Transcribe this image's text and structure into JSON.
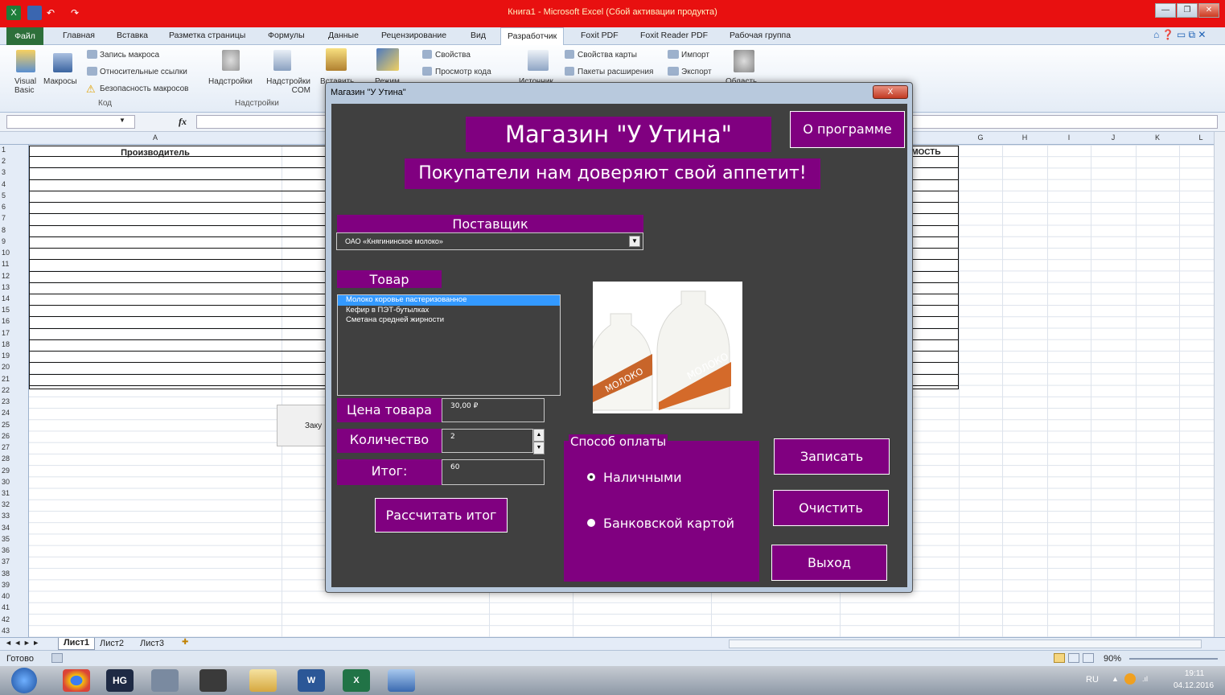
{
  "window": {
    "title": "Книга1 - Microsoft Excel (Сбой активации продукта)"
  },
  "ribbon": {
    "file_tab": "Файл",
    "tabs": [
      "Главная",
      "Вставка",
      "Разметка страницы",
      "Формулы",
      "Данные",
      "Рецензирование",
      "Вид",
      "Разработчик",
      "Foxit PDF",
      "Foxit Reader PDF",
      "Рабочая группа"
    ],
    "active_tab": "Разработчик",
    "code_group": {
      "visual_basic": "Visual Basic",
      "macros": "Макросы",
      "record_macro": "Запись макроса",
      "relative_refs": "Относительные ссылки",
      "macro_security": "Безопасность макросов",
      "label": "Код"
    },
    "addins_group": {
      "addins": "Надстройки",
      "com_addins": "Надстройки COM",
      "label": "Надстройки"
    },
    "controls_group": {
      "insert": "Вставить",
      "mode": "Режим",
      "properties": "Свойства",
      "view_code": "Просмотр кода"
    },
    "source_group": {
      "source": "Источник",
      "map_properties": "Свойства карты",
      "expansion_packs": "Пакеты расширения",
      "import": "Импорт",
      "export": "Экспорт"
    },
    "doc_panel": "Область"
  },
  "formula_bar": {
    "fx": "fx"
  },
  "sheet": {
    "columns": [
      "A",
      "G",
      "H",
      "I",
      "J",
      "K",
      "L"
    ],
    "header_a": "Производитель",
    "header_partial": "ИМОСТЬ",
    "rows": [
      "1",
      "2",
      "3",
      "4",
      "5",
      "6",
      "7",
      "8",
      "9",
      "10",
      "11",
      "12",
      "13",
      "14",
      "15",
      "16",
      "17",
      "18",
      "19",
      "20",
      "21",
      "22",
      "23",
      "24",
      "25",
      "26",
      "27",
      "28",
      "29",
      "30",
      "31",
      "32",
      "33",
      "34",
      "35",
      "36",
      "37",
      "38",
      "39",
      "40",
      "41",
      "42",
      "43"
    ],
    "side_button_partial": "Заку",
    "tabs": [
      "Лист1",
      "Лист2",
      "Лист3"
    ]
  },
  "status": {
    "ready": "Готово",
    "zoom": "90%"
  },
  "taskbar": {
    "lang": "RU",
    "time": "19:11",
    "date": "04.12.2016"
  },
  "dialog": {
    "title": "Магазин \"У Утина\"",
    "close": "X",
    "store_name": "Магазин \"У Утина\"",
    "slogan": "Покупатели нам доверяют свой аппетит!",
    "about_button": "О программе",
    "supplier_label": "Поставщик",
    "supplier_value": "ОАО «Княгининское молоко»",
    "product_label": "Товар",
    "products": [
      "Молоко коровье пастеризованное",
      "Кефир в ПЭТ-бутылках",
      "Сметана средней жирности"
    ],
    "selected_product": 0,
    "image_text": "МОЛОКО",
    "price_label": "Цена товара",
    "price_value": "30,00 ₽",
    "qty_label": "Количество",
    "qty_value": "2",
    "total_label": "Итог:",
    "total_value": "60",
    "calc_button": "Рассчитать итог",
    "payment_label": "Способ оплаты",
    "pay_cash": "Наличными",
    "pay_card": "Банковской картой",
    "save_button": "Записать",
    "clear_button": "Очистить",
    "exit_button": "Выход"
  }
}
